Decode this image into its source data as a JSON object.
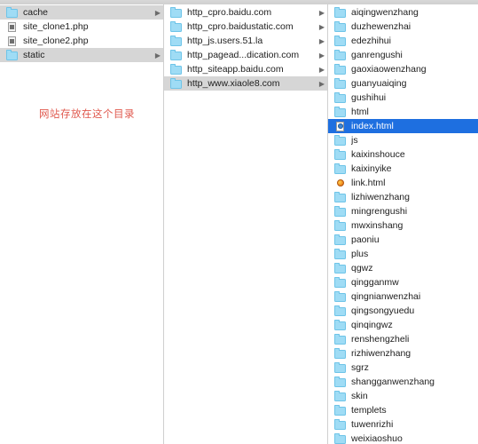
{
  "window": {
    "view_mode": "column-view",
    "colors": {
      "selection_active": "#1e6fe0",
      "selection_inactive": "#d6d6d6",
      "folder_icon": "#9fdcf5",
      "annotation": "#e05a4f",
      "divider": "#cfcfcf"
    }
  },
  "annotation": {
    "text": "网站存放在这个目录"
  },
  "columns": [
    {
      "name": "column-1",
      "items": [
        {
          "label": "cache",
          "icon": "folder-icon",
          "type": "folder",
          "chevron": "▶",
          "selected": "inactive"
        },
        {
          "label": "site_clone1.php",
          "icon": "php-document-icon",
          "type": "file",
          "chevron": "",
          "selected": "none"
        },
        {
          "label": "site_clone2.php",
          "icon": "php-document-icon",
          "type": "file",
          "chevron": "",
          "selected": "none"
        },
        {
          "label": "static",
          "icon": "folder-icon",
          "type": "folder",
          "chevron": "▶",
          "selected": "inactive"
        }
      ]
    },
    {
      "name": "column-2",
      "items": [
        {
          "label": "http_cpro.baidu.com",
          "icon": "folder-icon",
          "type": "folder",
          "chevron": "▶",
          "selected": "none"
        },
        {
          "label": "http_cpro.baidustatic.com",
          "icon": "folder-icon",
          "type": "folder",
          "chevron": "▶",
          "selected": "none"
        },
        {
          "label": "http_js.users.51.la",
          "icon": "folder-icon",
          "type": "folder",
          "chevron": "▶",
          "selected": "none"
        },
        {
          "label": "http_pagead...dication.com",
          "icon": "folder-icon",
          "type": "folder",
          "chevron": "▶",
          "selected": "none"
        },
        {
          "label": "http_siteapp.baidu.com",
          "icon": "folder-icon",
          "type": "folder",
          "chevron": "▶",
          "selected": "none"
        },
        {
          "label": "http_www.xiaole8.com",
          "icon": "folder-icon",
          "type": "folder",
          "chevron": "▶",
          "selected": "inactive"
        }
      ]
    },
    {
      "name": "column-3",
      "items": [
        {
          "label": "aiqingwenzhang",
          "icon": "folder-icon",
          "type": "folder",
          "chevron": "",
          "selected": "none"
        },
        {
          "label": "duzhewenzhai",
          "icon": "folder-icon",
          "type": "folder",
          "chevron": "",
          "selected": "none"
        },
        {
          "label": "edezhihui",
          "icon": "folder-icon",
          "type": "folder",
          "chevron": "",
          "selected": "none"
        },
        {
          "label": "ganrengushi",
          "icon": "folder-icon",
          "type": "folder",
          "chevron": "",
          "selected": "none"
        },
        {
          "label": "gaoxiaowenzhang",
          "icon": "folder-icon",
          "type": "folder",
          "chevron": "",
          "selected": "none"
        },
        {
          "label": "guanyuaiqing",
          "icon": "folder-icon",
          "type": "folder",
          "chevron": "",
          "selected": "none"
        },
        {
          "label": "gushihui",
          "icon": "folder-icon",
          "type": "folder",
          "chevron": "",
          "selected": "none"
        },
        {
          "label": "html",
          "icon": "folder-icon",
          "type": "folder",
          "chevron": "",
          "selected": "none"
        },
        {
          "label": "index.html",
          "icon": "html-document-icon",
          "type": "file",
          "chevron": "",
          "selected": "active"
        },
        {
          "label": "js",
          "icon": "folder-icon",
          "type": "folder",
          "chevron": "",
          "selected": "none"
        },
        {
          "label": "kaixinshouce",
          "icon": "folder-icon",
          "type": "folder",
          "chevron": "",
          "selected": "none"
        },
        {
          "label": "kaixinyike",
          "icon": "folder-icon",
          "type": "folder",
          "chevron": "",
          "selected": "none"
        },
        {
          "label": "link.html",
          "icon": "globe-document-icon",
          "type": "file",
          "chevron": "",
          "selected": "none"
        },
        {
          "label": "lizhiwenzhang",
          "icon": "folder-icon",
          "type": "folder",
          "chevron": "",
          "selected": "none"
        },
        {
          "label": "mingrengushi",
          "icon": "folder-icon",
          "type": "folder",
          "chevron": "",
          "selected": "none"
        },
        {
          "label": "mwxinshang",
          "icon": "folder-icon",
          "type": "folder",
          "chevron": "",
          "selected": "none"
        },
        {
          "label": "paoniu",
          "icon": "folder-icon",
          "type": "folder",
          "chevron": "",
          "selected": "none"
        },
        {
          "label": "plus",
          "icon": "folder-icon",
          "type": "folder",
          "chevron": "",
          "selected": "none"
        },
        {
          "label": "qgwz",
          "icon": "folder-icon",
          "type": "folder",
          "chevron": "",
          "selected": "none"
        },
        {
          "label": "qingganmw",
          "icon": "folder-icon",
          "type": "folder",
          "chevron": "",
          "selected": "none"
        },
        {
          "label": "qingnianwenzhai",
          "icon": "folder-icon",
          "type": "folder",
          "chevron": "",
          "selected": "none"
        },
        {
          "label": "qingsongyuedu",
          "icon": "folder-icon",
          "type": "folder",
          "chevron": "",
          "selected": "none"
        },
        {
          "label": "qinqingwz",
          "icon": "folder-icon",
          "type": "folder",
          "chevron": "",
          "selected": "none"
        },
        {
          "label": "renshengzheli",
          "icon": "folder-icon",
          "type": "folder",
          "chevron": "",
          "selected": "none"
        },
        {
          "label": "rizhiwenzhang",
          "icon": "folder-icon",
          "type": "folder",
          "chevron": "",
          "selected": "none"
        },
        {
          "label": "sgrz",
          "icon": "folder-icon",
          "type": "folder",
          "chevron": "",
          "selected": "none"
        },
        {
          "label": "shangganwenzhang",
          "icon": "folder-icon",
          "type": "folder",
          "chevron": "",
          "selected": "none"
        },
        {
          "label": "skin",
          "icon": "folder-icon",
          "type": "folder",
          "chevron": "",
          "selected": "none"
        },
        {
          "label": "templets",
          "icon": "folder-icon",
          "type": "folder",
          "chevron": "",
          "selected": "none"
        },
        {
          "label": "tuwenrizhi",
          "icon": "folder-icon",
          "type": "folder",
          "chevron": "",
          "selected": "none"
        },
        {
          "label": "weixiaoshuo",
          "icon": "folder-icon",
          "type": "folder",
          "chevron": "",
          "selected": "none"
        }
      ]
    }
  ]
}
